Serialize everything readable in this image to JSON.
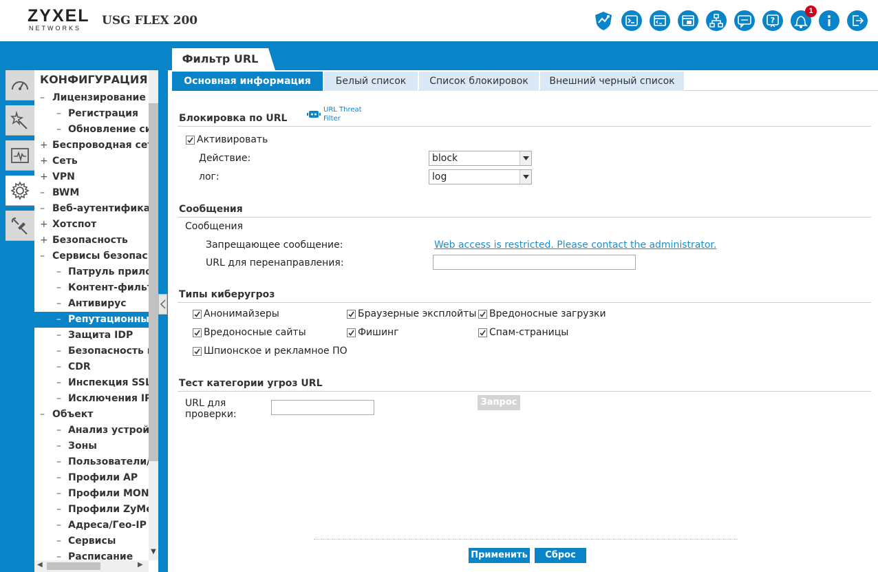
{
  "header": {
    "logo_main": "ZYXEL",
    "logo_sub": "NETWORKS",
    "model": "USG FLEX 200",
    "notification_count": "1",
    "icons": [
      "shield-icon",
      "console-icon",
      "cli-icon",
      "browser-icon",
      "network-map-icon",
      "chat-icon",
      "help-icon",
      "notification-bell-icon",
      "info-icon",
      "logout-icon"
    ]
  },
  "sidebar": {
    "title": "КОНФИГУРАЦИЯ",
    "icons": [
      "dashboard-icon",
      "quick-setup-icon",
      "monitor-icon",
      "configuration-icon",
      "maintenance-icon"
    ],
    "items": [
      {
        "pm": "–",
        "label": "Лицензирование",
        "level": 1
      },
      {
        "pm": "–",
        "label": "Регистрация",
        "level": 2
      },
      {
        "pm": "–",
        "label": "Обновление сиг",
        "level": 2
      },
      {
        "pm": "+",
        "label": "Беспроводная сеть",
        "level": 1
      },
      {
        "pm": "+",
        "label": "Сеть",
        "level": 1
      },
      {
        "pm": "+",
        "label": "VPN",
        "level": 1
      },
      {
        "pm": "–",
        "label": "BWM",
        "level": 1
      },
      {
        "pm": "–",
        "label": "Веб-аутентификац",
        "level": 1
      },
      {
        "pm": "+",
        "label": "Хотспот",
        "level": 1
      },
      {
        "pm": "+",
        "label": "Безопасность",
        "level": 1
      },
      {
        "pm": "–",
        "label": "Сервисы безопасно",
        "level": 1
      },
      {
        "pm": "–",
        "label": "Патруль прилож",
        "level": 2
      },
      {
        "pm": "–",
        "label": "Контент-фильтр",
        "level": 2
      },
      {
        "pm": "–",
        "label": "Антивирус",
        "level": 2
      },
      {
        "pm": "–",
        "label": "Репутационный",
        "level": 2,
        "selected": true
      },
      {
        "pm": "–",
        "label": "Защита IDP",
        "level": 2
      },
      {
        "pm": "–",
        "label": "Безопасность по",
        "level": 2
      },
      {
        "pm": "–",
        "label": "CDR",
        "level": 2
      },
      {
        "pm": "–",
        "label": "Инспекция SSL",
        "level": 2
      },
      {
        "pm": "–",
        "label": "Исключения IP-",
        "level": 2
      },
      {
        "pm": "–",
        "label": "Объект",
        "level": 1
      },
      {
        "pm": "–",
        "label": "Анализ устройс",
        "level": 2
      },
      {
        "pm": "–",
        "label": "Зоны",
        "level": 2
      },
      {
        "pm": "–",
        "label": "Пользователи/г",
        "level": 2
      },
      {
        "pm": "–",
        "label": "Профили AP",
        "level": 2
      },
      {
        "pm": "–",
        "label": "Профили MON",
        "level": 2
      },
      {
        "pm": "–",
        "label": "Профили ZyMes",
        "level": 2
      },
      {
        "pm": "–",
        "label": "Адреса/Гео-IP",
        "level": 2
      },
      {
        "pm": "–",
        "label": "Сервисы",
        "level": 2
      },
      {
        "pm": "–",
        "label": "Расписание",
        "level": 2
      }
    ]
  },
  "page": {
    "tab_title": "Фильтр URL",
    "subtabs": [
      "Основная информация",
      "Белый список",
      "Список блокировок",
      "Внешний черный список"
    ],
    "url_block": {
      "title": "Блокировка по URL",
      "threat_link": "URL Threat Filter",
      "activate_label": "Активировать",
      "activate_checked": true,
      "action_label": "Действие:",
      "action_value": "block",
      "log_label": "лог:",
      "log_value": "log"
    },
    "messages": {
      "title": "Сообщения",
      "subtitle": "Сообщения",
      "deny_label": "Запрещающее сообщение:",
      "deny_value": "Web access is restricted. Please contact the administrator.",
      "redirect_label": "URL для перенаправления:",
      "redirect_value": ""
    },
    "threats": {
      "title": "Типы киберугроз",
      "items": [
        {
          "label": "Анонимайзеры",
          "checked": true
        },
        {
          "label": "Браузерные эксплойты",
          "checked": true
        },
        {
          "label": "Вредоносные загрузки",
          "checked": true
        },
        {
          "label": "Вредоносные сайты",
          "checked": true
        },
        {
          "label": "Фишинг",
          "checked": true
        },
        {
          "label": "Спам-страницы",
          "checked": true
        },
        {
          "label": "Шпионское и рекламное ПО",
          "checked": true
        }
      ]
    },
    "test": {
      "title": "Тест категории угроз URL",
      "url_label_1": "URL для",
      "url_label_2": "проверки:",
      "query_button": "Запрос"
    },
    "buttons": {
      "apply": "Применить",
      "reset": "Сброс"
    }
  }
}
